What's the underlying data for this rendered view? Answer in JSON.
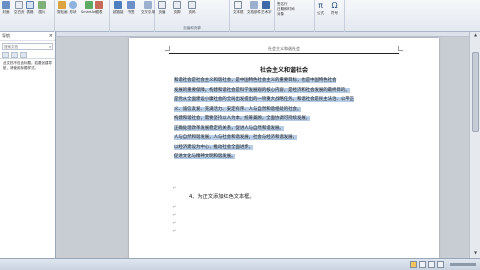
{
  "ribbon": {
    "b1": "封面",
    "b2": "空白页",
    "b3": "表格",
    "b4": "图片",
    "b5": "剪贴画",
    "b6": "形状",
    "b7": "SmartArt",
    "b8": "图表",
    "b9": "超链接",
    "b10": "书签",
    "b11": "交叉引用",
    "b12": "页眉",
    "b13": "页脚",
    "b14": "页码",
    "group_header": "页眉和页脚",
    "b15": "文本框",
    "b16": "文档部件",
    "b17": "艺术字",
    "s1": "签名行",
    "s2": "日期和时间",
    "s3": "对象",
    "pi": "π",
    "omega": "Ω",
    "b18": "公式",
    "b19": "符号"
  },
  "nav": {
    "title": "导航",
    "close": "×",
    "search_placeholder": "搜索文档",
    "search_icon": "⌕",
    "message": "此文档不包含标题。若要创建导航，请使用标题样式。"
  },
  "doc": {
    "header": "社会主义和谐社会",
    "title": "社会主义和谐社会",
    "lines": [
      "和谐社会是社会主义和谐社会，是中国特色社会主义的重要目标，也是中国特色社会",
      "发展的重要保障。构建和谐社会是科学发展观的核心内容，是经济和社会发展的最终目的。",
      "是党从全面建设小康社会的全局出发提出的一项重大战略任务。和谐社会是民主法治、公平正",
      "义、诚信友爱、充满活力、安定有序、人与自然和谐相处的社会。",
      "构建和谐社会，需要坚持以人为本，统筹兼顾，全面协调可持续发展，",
      "正确处理改革发展稳定的关系，促进人与自然和谐发展。",
      "人与自然和谐发展，人与社会和谐发展，社会与经济和谐发展，",
      "以经济建设为中心，推动社会全面进步。",
      "促进文化与精神文明和谐发展。",
      ""
    ],
    "mark": "↵",
    "task": "4、为正文添加红色文本框。"
  },
  "scroll": {
    "up": "▲",
    "down": "▼"
  },
  "status": {
    "left": ""
  }
}
